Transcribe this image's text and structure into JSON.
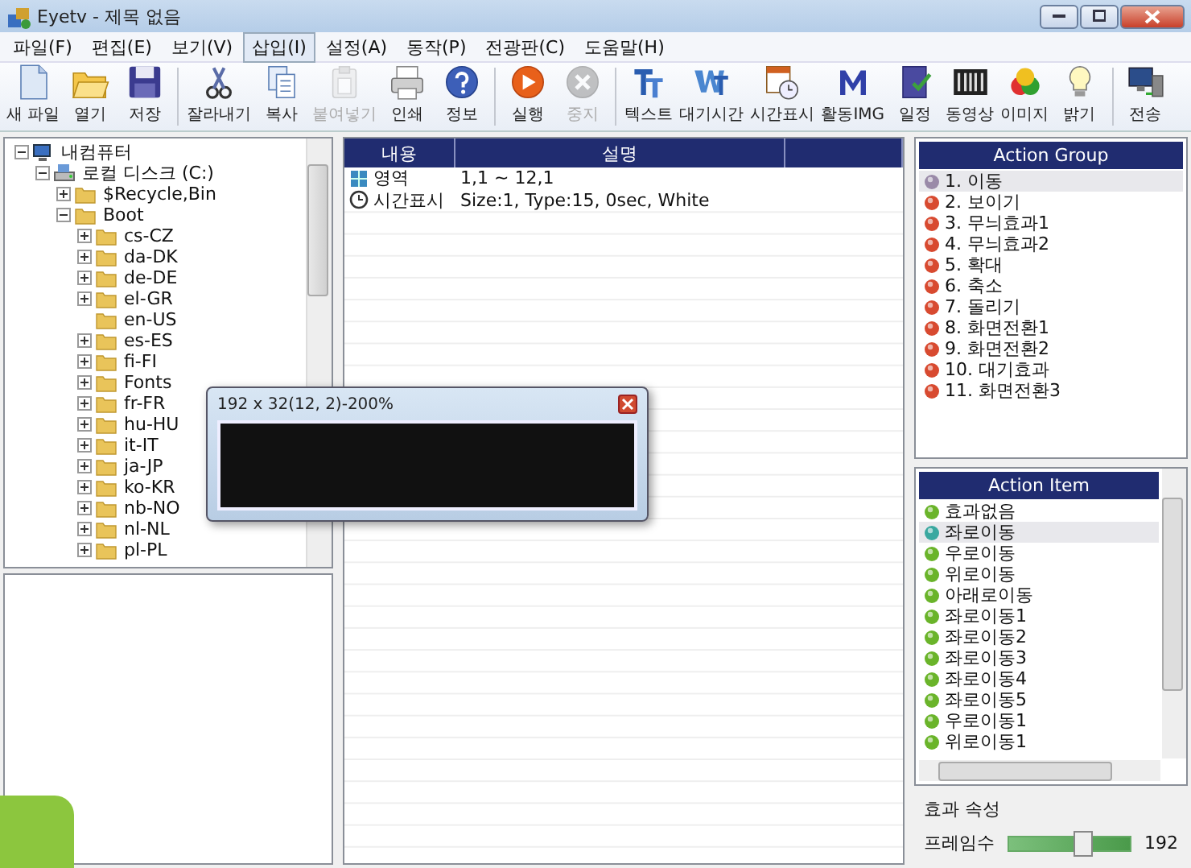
{
  "window": {
    "title": "Eyetv - 제목 없음"
  },
  "menu": [
    {
      "label": "파일(F)",
      "selected": false
    },
    {
      "label": "편집(E)",
      "selected": false
    },
    {
      "label": "보기(V)",
      "selected": false
    },
    {
      "label": "삽입(I)",
      "selected": true
    },
    {
      "label": "설정(A)",
      "selected": false
    },
    {
      "label": "동작(P)",
      "selected": false
    },
    {
      "label": "전광판(C)",
      "selected": false
    },
    {
      "label": "도움말(H)",
      "selected": false
    }
  ],
  "toolbar": [
    [
      {
        "label": "새 파일",
        "disabled": false
      },
      {
        "label": "열기",
        "disabled": false
      },
      {
        "label": "저장",
        "disabled": false
      }
    ],
    [
      {
        "label": "잘라내기",
        "disabled": false
      },
      {
        "label": "복사",
        "disabled": false
      },
      {
        "label": "붙여넣기",
        "disabled": true
      },
      {
        "label": "인쇄",
        "disabled": false
      },
      {
        "label": "정보",
        "disabled": false
      }
    ],
    [
      {
        "label": "실행",
        "disabled": false
      },
      {
        "label": "중지",
        "disabled": true
      }
    ],
    [
      {
        "label": "텍스트",
        "disabled": false
      },
      {
        "label": "대기시간",
        "disabled": false
      },
      {
        "label": "시간표시",
        "disabled": false
      },
      {
        "label": "활동IMG",
        "disabled": false
      },
      {
        "label": "일정",
        "disabled": false
      },
      {
        "label": "동영상",
        "disabled": false
      },
      {
        "label": "이미지",
        "disabled": false
      },
      {
        "label": "밝기",
        "disabled": false
      }
    ],
    [
      {
        "label": "전송",
        "disabled": false
      }
    ]
  ],
  "tree": [
    {
      "label": "내컴퓨터",
      "kind": "computer",
      "expanded": true,
      "children": [
        {
          "label": "로컬 디스크 (C:)",
          "kind": "drive",
          "expanded": true,
          "children": [
            {
              "label": "$Recycle,Bin",
              "kind": "folder",
              "expanded": false
            },
            {
              "label": "Boot",
              "kind": "folder",
              "expanded": true,
              "children": [
                {
                  "label": "cs-CZ",
                  "kind": "folder",
                  "expanded": false
                },
                {
                  "label": "da-DK",
                  "kind": "folder",
                  "expanded": false
                },
                {
                  "label": "de-DE",
                  "kind": "folder",
                  "expanded": false
                },
                {
                  "label": "el-GR",
                  "kind": "folder",
                  "expanded": false
                },
                {
                  "label": "en-US",
                  "kind": "folder"
                },
                {
                  "label": "es-ES",
                  "kind": "folder",
                  "expanded": false
                },
                {
                  "label": "fi-FI",
                  "kind": "folder",
                  "expanded": false
                },
                {
                  "label": "Fonts",
                  "kind": "folder",
                  "expanded": false
                },
                {
                  "label": "fr-FR",
                  "kind": "folder",
                  "expanded": false
                },
                {
                  "label": "hu-HU",
                  "kind": "folder",
                  "expanded": false
                },
                {
                  "label": "it-IT",
                  "kind": "folder",
                  "expanded": false
                },
                {
                  "label": "ja-JP",
                  "kind": "folder",
                  "expanded": false
                },
                {
                  "label": "ko-KR",
                  "kind": "folder",
                  "expanded": false
                },
                {
                  "label": "nb-NO",
                  "kind": "folder",
                  "expanded": false
                },
                {
                  "label": "nl-NL",
                  "kind": "folder",
                  "expanded": false
                },
                {
                  "label": "pl-PL",
                  "kind": "folder",
                  "expanded": false
                }
              ]
            }
          ]
        }
      ]
    }
  ],
  "table": {
    "columns": [
      "내용",
      "설명"
    ],
    "rows": [
      {
        "kind": "area",
        "content": "영역",
        "description": "1,1 ~ 12,1"
      },
      {
        "kind": "clock",
        "content": "시간표시",
        "description": "Size:1, Type:15, 0sec, White"
      }
    ]
  },
  "action_group": {
    "title": "Action Group",
    "items": [
      {
        "label": "1. 이동",
        "selected": true
      },
      {
        "label": "2. 보이기",
        "selected": false
      },
      {
        "label": "3. 무늬효과1",
        "selected": false
      },
      {
        "label": "4. 무늬효과2",
        "selected": false
      },
      {
        "label": "5. 확대",
        "selected": false
      },
      {
        "label": "6. 축소",
        "selected": false
      },
      {
        "label": "7. 돌리기",
        "selected": false
      },
      {
        "label": "8. 화면전환1",
        "selected": false
      },
      {
        "label": "9. 화면전환2",
        "selected": false
      },
      {
        "label": "10. 대기효과",
        "selected": false
      },
      {
        "label": "11. 화면전환3",
        "selected": false
      }
    ]
  },
  "action_item": {
    "title": "Action Item",
    "items": [
      {
        "label": "효과없음",
        "selected": false
      },
      {
        "label": "좌로이동",
        "selected": true
      },
      {
        "label": "우로이동",
        "selected": false
      },
      {
        "label": "위로이동",
        "selected": false
      },
      {
        "label": "아래로이동",
        "selected": false
      },
      {
        "label": "좌로이동1",
        "selected": false
      },
      {
        "label": "좌로이동2",
        "selected": false
      },
      {
        "label": "좌로이동3",
        "selected": false
      },
      {
        "label": "좌로이동4",
        "selected": false
      },
      {
        "label": "좌로이동5",
        "selected": false
      },
      {
        "label": "우로이동1",
        "selected": false
      },
      {
        "label": "위로이동1",
        "selected": false
      }
    ]
  },
  "properties": {
    "title": "효과 속성",
    "frame": {
      "label": "프레임수",
      "level": 0.6,
      "reading": "192"
    }
  },
  "dialog": {
    "title": "192 x 32(12, 2)-200%"
  }
}
